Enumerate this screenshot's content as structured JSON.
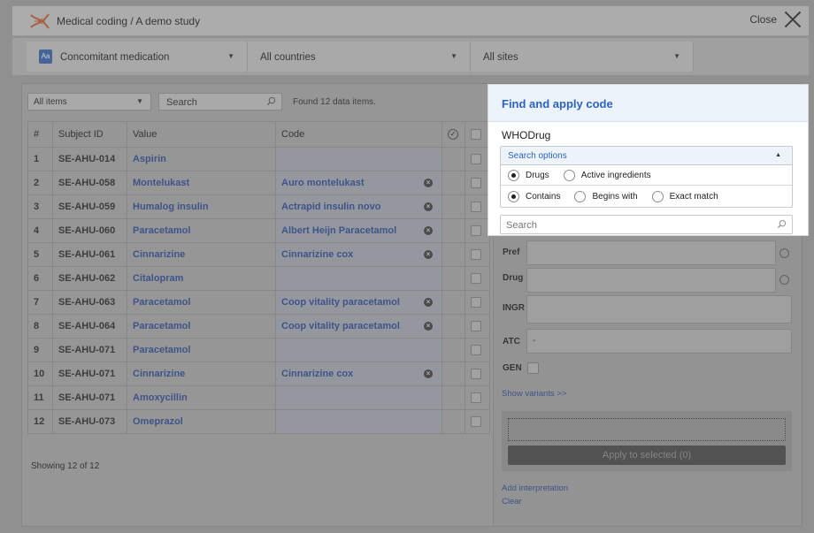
{
  "app": {
    "title": "Medical coding / A demo study",
    "close_label": "Close"
  },
  "filters": {
    "form": "Concomitant medication",
    "form_icon": "Aa",
    "countries": "All countries",
    "sites": "All sites"
  },
  "toolbar": {
    "items_filter": "All items",
    "search_value": "Search",
    "found_text": "Found 12 data items."
  },
  "table": {
    "headers": [
      "#",
      "Subject ID",
      "Value",
      "Code"
    ],
    "rows": [
      {
        "n": "1",
        "subject": "SE-AHU-014",
        "value": "Aspirin",
        "code": ""
      },
      {
        "n": "2",
        "subject": "SE-AHU-058",
        "value": "Montelukast",
        "code": "Auro montelukast"
      },
      {
        "n": "3",
        "subject": "SE-AHU-059",
        "value": "Humalog insulin",
        "code": "Actrapid insulin novo"
      },
      {
        "n": "4",
        "subject": "SE-AHU-060",
        "value": "Paracetamol",
        "code": "Albert Heijn Paracetamol"
      },
      {
        "n": "5",
        "subject": "SE-AHU-061",
        "value": "Cinnarizine",
        "code": "Cinnarizine cox"
      },
      {
        "n": "6",
        "subject": "SE-AHU-062",
        "value": "Citalopram",
        "code": ""
      },
      {
        "n": "7",
        "subject": "SE-AHU-063",
        "value": "Paracetamol",
        "code": "Coop vitality paracetamol"
      },
      {
        "n": "8",
        "subject": "SE-AHU-064",
        "value": "Paracetamol",
        "code": "Coop vitality paracetamol"
      },
      {
        "n": "9",
        "subject": "SE-AHU-071",
        "value": "Paracetamol",
        "code": ""
      },
      {
        "n": "10",
        "subject": "SE-AHU-071",
        "value": "Cinnarizine",
        "code": "Cinnarizine cox"
      },
      {
        "n": "11",
        "subject": "SE-AHU-071",
        "value": "Amoxycillin",
        "code": ""
      },
      {
        "n": "12",
        "subject": "SE-AHU-073",
        "value": "Omeprazol",
        "code": ""
      }
    ],
    "showing_text": "Showing 12 of 12"
  },
  "find_code": {
    "title": "Find and apply code",
    "dictionary": "WHODrug",
    "search_options_label": "Search options",
    "type_options": [
      "Drugs",
      "Active ingredients"
    ],
    "type_selected": "Drugs",
    "match_options": [
      "Contains",
      "Begins with",
      "Exact match"
    ],
    "match_selected": "Contains",
    "search_placeholder": "Search"
  },
  "detail": {
    "pref_label": "Pref",
    "drug_label": "Drug",
    "ingr_label": "INGR",
    "atc_label": "ATC",
    "atc_value": "-",
    "gen_label": "GEN",
    "show_variants": "Show variants >>",
    "apply_button": "Apply to selected (0)",
    "add_interpretation": "Add interpretation",
    "clear": "Clear"
  }
}
